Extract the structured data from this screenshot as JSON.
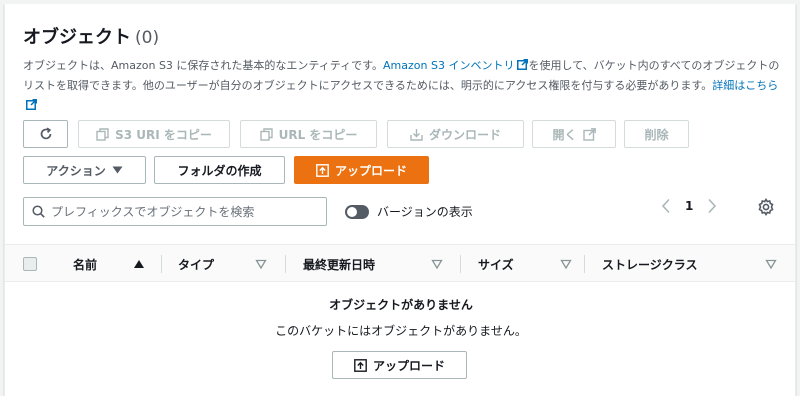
{
  "header": {
    "title": "オブジェクト",
    "count": "(0)",
    "description_part1": "オブジェクトは、Amazon S3 に保存された基本的なエンティティです。",
    "inventory_link": "Amazon S3 インベントリ",
    "description_part2": "を使用して、バケット内のすべてのオブジェクトのリストを取得できます。他のユーザーが自分のオブジェクトにアクセスできるためには、明示的にアクセス権限を付与する必要があります。",
    "details_link": "詳細はこちら"
  },
  "toolbar": {
    "refresh_icon": "refresh-icon",
    "copy_s3_uri": "S3 URI をコピー",
    "copy_url": "URL をコピー",
    "download": "ダウンロード",
    "open": "開く",
    "delete": "削除",
    "actions": "アクション",
    "create_folder": "フォルダの作成",
    "upload": "アップロード"
  },
  "search": {
    "placeholder": "プレフィックスでオブジェクトを検索"
  },
  "versions_toggle": {
    "label": "バージョンの表示"
  },
  "pagination": {
    "current_page": "1"
  },
  "table": {
    "columns": [
      "名前",
      "タイプ",
      "最終更新日時",
      "サイズ",
      "ストレージクラス"
    ],
    "rows": []
  },
  "empty_state": {
    "title": "オブジェクトがありません",
    "description": "このバケットにはオブジェクトがありません。",
    "upload_button": "アップロード"
  },
  "colors": {
    "primary": "#ec7211",
    "link": "#0073bb",
    "disabled": "#aab7b8"
  }
}
